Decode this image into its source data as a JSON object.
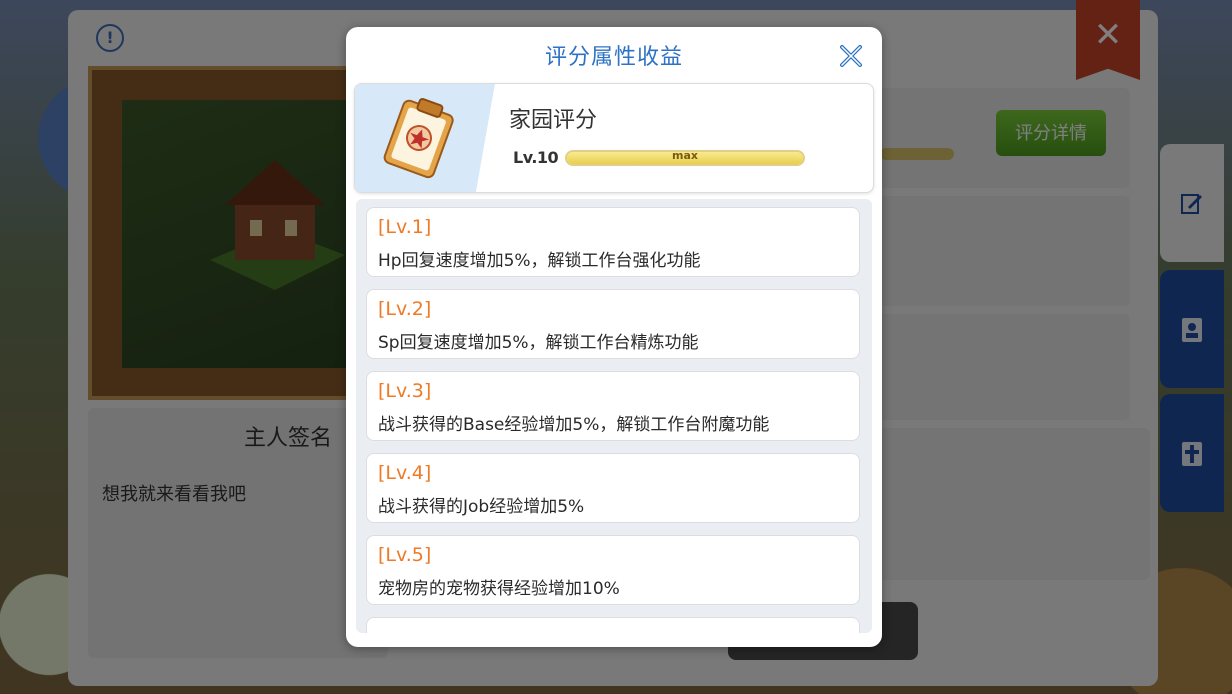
{
  "background": {
    "signature_title": "主人签名",
    "signature_text": "想我就来看看我吧",
    "detail_button_label": "评分详情",
    "close_label": "✕"
  },
  "dialog": {
    "title": "评分属性收益",
    "header": {
      "name": "家园评分",
      "level": "Lv.10",
      "progress_text": "max",
      "progress_fraction": 1.0,
      "icon": "clipboard-star-icon"
    },
    "items": [
      {
        "level": "[Lv.1]",
        "desc": "Hp回复速度增加5%，解锁工作台强化功能"
      },
      {
        "level": "[Lv.2]",
        "desc": "Sp回复速度增加5%，解锁工作台精炼功能"
      },
      {
        "level": "[Lv.3]",
        "desc": "战斗获得的Base经验增加5%，解锁工作台附魔功能"
      },
      {
        "level": "[Lv.4]",
        "desc": "战斗获得的Job经验增加5%"
      },
      {
        "level": "[Lv.5]",
        "desc": "宠物房的宠物获得经验增加10%"
      }
    ]
  },
  "colors": {
    "title_blue": "#2e72c4",
    "level_orange": "#ef7a25",
    "tab_blue": "#1f4fa0"
  }
}
